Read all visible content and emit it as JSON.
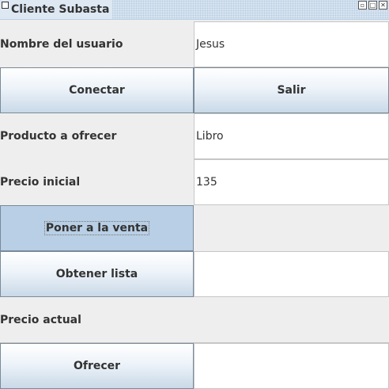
{
  "window": {
    "title": "Cliente Subasta",
    "controls": {
      "minimize": "▫",
      "maximize": "□",
      "close": "✕"
    }
  },
  "form": {
    "user_label": "Nombre del usuario",
    "user_value": "Jesus",
    "connect_label": "Conectar",
    "exit_label": "Salir",
    "product_label": "Producto a ofrecer",
    "product_value": "Libro",
    "price_label": "Precio inicial",
    "price_value": "135",
    "sell_label": "Poner a la venta",
    "list_label": "Obtener lista",
    "current_price_label": "Precio actual",
    "offer_label": "Ofrecer",
    "offer_value": ""
  }
}
